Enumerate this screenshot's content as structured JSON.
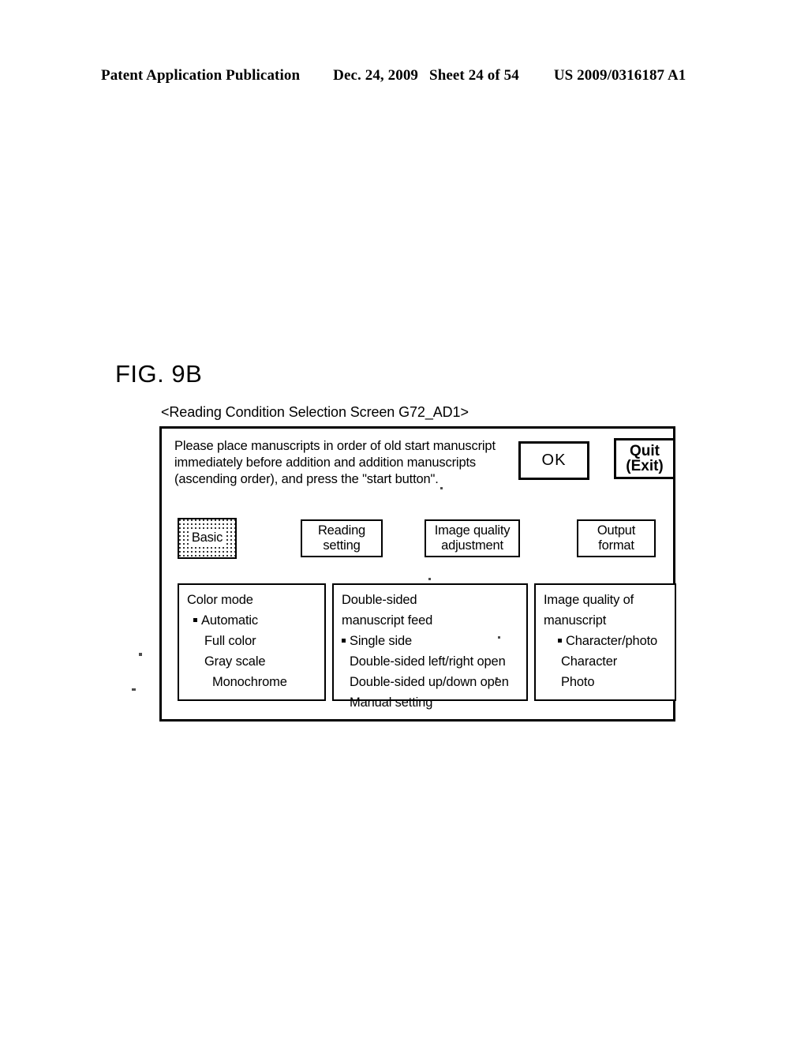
{
  "header": {
    "publication": "Patent Application Publication",
    "date": "Dec. 24, 2009",
    "sheet": "Sheet 24 of 54",
    "patent_number": "US 2009/0316187 A1"
  },
  "figure": {
    "label": "FIG. 9B",
    "caption": "<Reading Condition Selection Screen G72_AD1>"
  },
  "screen": {
    "instruction": {
      "line1": "Please place manuscripts in order of old start manuscript",
      "line2": "immediately before addition and addition manuscripts",
      "line3": "(ascending order), and press the \"start button\"."
    },
    "buttons": {
      "ok": "OK",
      "quit_line1": "Quit",
      "quit_line2": "(Exit)"
    },
    "tabs": [
      {
        "label": "Basic",
        "selected": true
      },
      {
        "line1": "Reading",
        "line2": "setting",
        "selected": false
      },
      {
        "line1": "Image quality",
        "line2": "adjustment",
        "selected": false
      },
      {
        "line1": "Output",
        "line2": "format",
        "selected": false
      }
    ],
    "panels": {
      "color_mode": {
        "title": "Color mode",
        "options": [
          "Automatic",
          "Full color",
          "Gray scale",
          "Monochrome"
        ],
        "selected": "Automatic"
      },
      "duplex_feed": {
        "title_line1": "Double-sided",
        "title_line2": "manuscript feed",
        "options": [
          "Single side",
          "Double-sided left/right open",
          "Double-sided up/down open",
          "Manual setting"
        ],
        "selected": "Single side"
      },
      "image_quality": {
        "title_line1": "Image quality of",
        "title_line2": "manuscript",
        "options": [
          "Character/photo",
          "Character",
          "Photo"
        ],
        "selected": "Character/photo"
      }
    }
  },
  "colors": {
    "ink": "#000000",
    "paper": "#ffffff"
  }
}
